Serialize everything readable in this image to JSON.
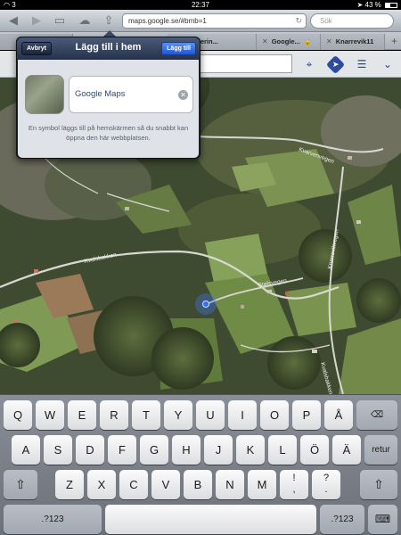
{
  "status": {
    "carrier": "3",
    "time": "22:37",
    "battery": "43 %",
    "battery_level": 0.43
  },
  "toolbar": {
    "back_icon": "back-arrow",
    "forward_icon": "forward-arrow",
    "bookmarks_icon": "book-icon",
    "icloud_icon": "cloud-icon",
    "share_icon": "share-icon",
    "url": "maps.google.se/#bmb=1",
    "search_placeholder": "Sök"
  },
  "tabs": [
    {
      "label": "Uppgraderin..."
    },
    {
      "label": "Google..."
    },
    {
      "label": "Knarrevik11"
    }
  ],
  "map": {
    "streets": [
      "Kvarvenvegen",
      "Kvalsbakken",
      "Stølsvegen",
      "Knarrevikvegen",
      "Kvalsbakken"
    ]
  },
  "popover": {
    "cancel": "Avbryt",
    "title": "Lägg till i hem",
    "add": "Lägg till",
    "name": "Google Maps",
    "hint": "En symbol läggs till på hemskärmen så du snabbt kan öppna den här webbplatsen."
  },
  "keyboard": {
    "row1": [
      "Q",
      "W",
      "E",
      "R",
      "T",
      "Y",
      "U",
      "I",
      "O",
      "P",
      "Å"
    ],
    "row2": [
      "A",
      "S",
      "D",
      "F",
      "G",
      "H",
      "J",
      "K",
      "L",
      "Ö",
      "Ä"
    ],
    "row3": [
      "Z",
      "X",
      "C",
      "V",
      "B",
      "N",
      "M"
    ],
    "punct1": [
      "!",
      ","
    ],
    "punct2": [
      "?",
      "."
    ],
    "numbers": ".?123",
    "return": "retur"
  }
}
